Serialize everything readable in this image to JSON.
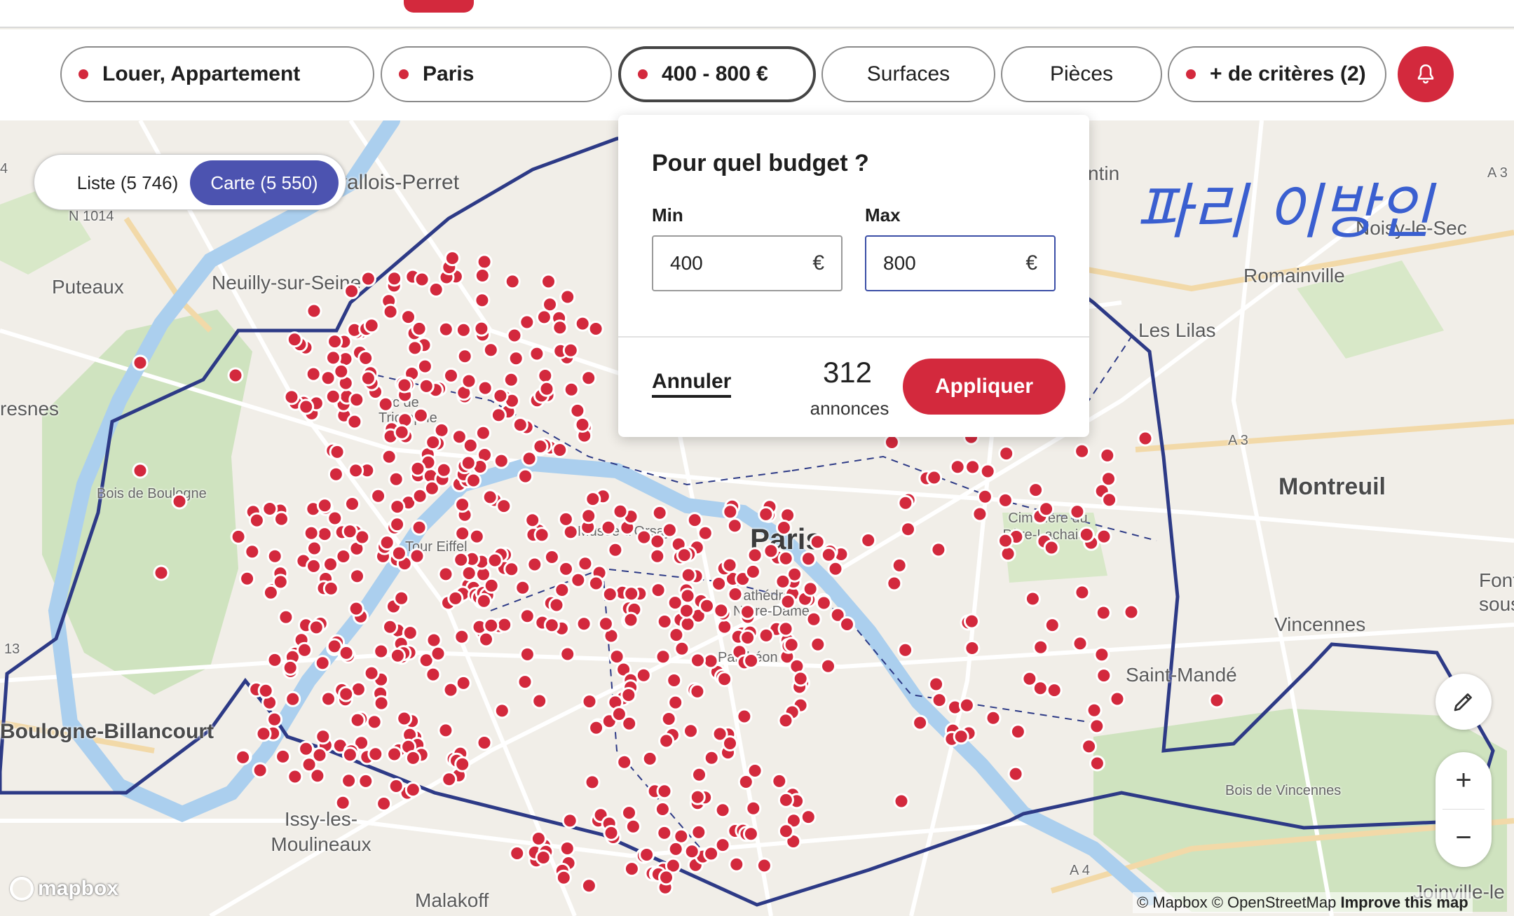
{
  "filters": {
    "type": "Louer, Appartement",
    "location": "Paris",
    "budget": "400 - 800 €",
    "surfaces": "Surfaces",
    "rooms": "Pièces",
    "more": "+ de critères (2)"
  },
  "colors": {
    "accent": "#d3293d",
    "toggle_active": "#4c53b0",
    "boundary": "#2d3a86"
  },
  "view_toggle": {
    "list": "Liste (5 746)",
    "map": "Carte (5 550)"
  },
  "budget_popup": {
    "title": "Pour quel budget ?",
    "min_label": "Min",
    "max_label": "Max",
    "min_value": "400",
    "max_value": "800",
    "currency": "€",
    "cancel": "Annuler",
    "count": "312",
    "count_label": "annonces",
    "apply": "Appliquer"
  },
  "map_labels": {
    "levallois": "vallois-Perret",
    "n1014": "N 1014",
    "puteaux": "Puteaux",
    "neuilly": "Neuilly-sur-Seine",
    "resnes": "resnes",
    "bois_boulogne": "Bois de Boulogne",
    "arc": "Arc de Triomphe",
    "tour_eiffel": "Tour Eiffel",
    "musee": "Musée d'Orsay",
    "paris": "Paris",
    "cathedrale": "Cathédrale Notre-Dame",
    "pantheon": "Panthéon",
    "boulogne": "Boulogne-Billancourt",
    "issy": "Issy-les-Moulineaux",
    "malakoff": "Malakoff",
    "pantin": "ntin",
    "romainville": "Romainville",
    "les_lilas": "Les Lilas",
    "noisy": "Noisy-le-Sec",
    "a3_top": "A 3",
    "a3_mid": "A 3",
    "montreuil": "Montreuil",
    "cimetiere": "Cimetière du Père-Lachaise",
    "fontenay": "Font sous",
    "vincennes": "Vincennes",
    "saint_mande": "Saint-Mandé",
    "bois_vincennes": "Bois de Vincennes",
    "a4": "A 4",
    "joinville": "Joinville-le",
    "n13": "13",
    "n4": "4",
    "korean_note": "파리 이방인"
  },
  "map_controls": {
    "zoom_in": "+",
    "zoom_out": "−"
  },
  "mapbox_logo": "mapbox",
  "attribution": {
    "mapbox": "© Mapbox",
    "osm": "© OpenStreetMap",
    "improve": "Improve this map"
  }
}
